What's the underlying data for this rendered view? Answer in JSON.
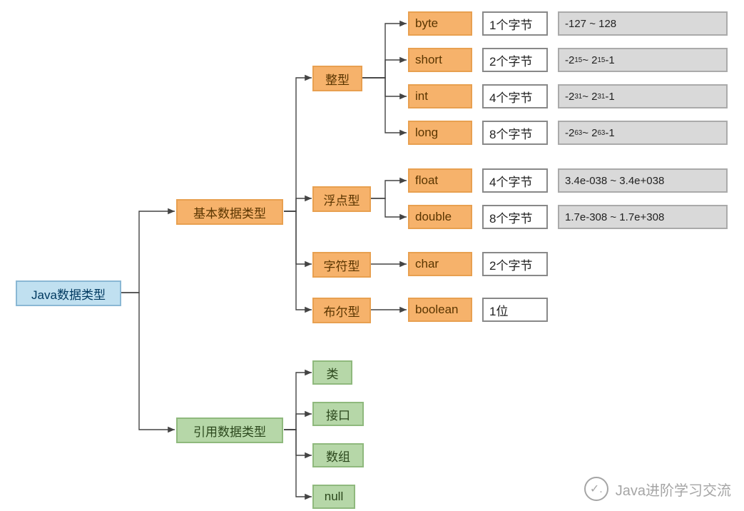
{
  "root": {
    "label": "Java数据类型"
  },
  "basic": {
    "label": "基本数据类型",
    "groups": {
      "integer": {
        "label": "整型",
        "items": [
          {
            "name": "byte",
            "size": "1个字节",
            "range": "-127 ~ 128"
          },
          {
            "name": "short",
            "size": "2个字节",
            "range": "-2^15 ~ 2^15-1",
            "range_html": "-2<sup>15</sup> ~ 2<sup>15</sup>-1"
          },
          {
            "name": "int",
            "size": "4个字节",
            "range": "-2^31 ~ 2^31-1",
            "range_html": "-2<sup>31</sup> ~ 2<sup>31</sup>-1"
          },
          {
            "name": "long",
            "size": "8个字节",
            "range": "-2^63 ~ 2^63-1",
            "range_html": "-2<sup>63</sup> ~ 2<sup>63</sup>-1"
          }
        ]
      },
      "float": {
        "label": "浮点型",
        "items": [
          {
            "name": "float",
            "size": "4个字节",
            "range": "3.4e-038 ~ 3.4e+038"
          },
          {
            "name": "double",
            "size": "8个字节",
            "range": "1.7e-308 ~ 1.7e+308"
          }
        ]
      },
      "char": {
        "label": "字符型",
        "items": [
          {
            "name": "char",
            "size": "2个字节"
          }
        ]
      },
      "bool": {
        "label": "布尔型",
        "items": [
          {
            "name": "boolean",
            "size": "1位"
          }
        ]
      }
    }
  },
  "reference": {
    "label": "引用数据类型",
    "items": [
      {
        "name": "类"
      },
      {
        "name": "接口"
      },
      {
        "name": "数组"
      },
      {
        "name": "null"
      }
    ]
  },
  "watermark": {
    "text": "Java进阶学习交流"
  },
  "colors": {
    "root_bg": "#c0e0f0",
    "orange_bg": "#f6b26b",
    "green_bg": "#b6d7a8",
    "gray_bg": "#d9d9d9"
  }
}
